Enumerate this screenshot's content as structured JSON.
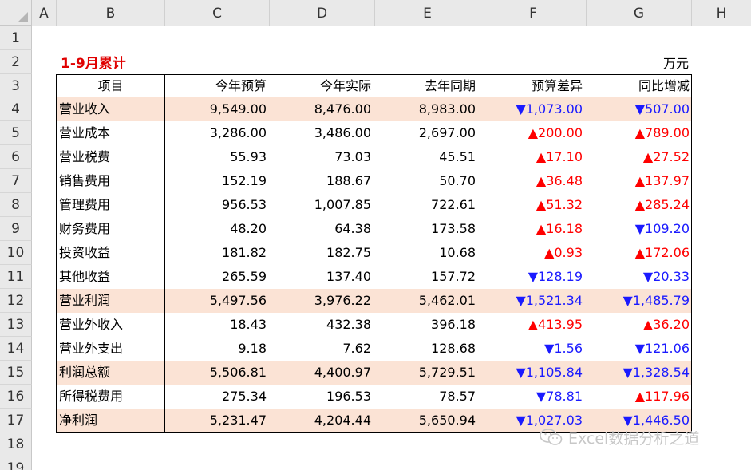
{
  "columns": [
    "A",
    "B",
    "C",
    "D",
    "E",
    "F",
    "G",
    "H"
  ],
  "rows": [
    "1",
    "2",
    "3",
    "4",
    "5",
    "6",
    "7",
    "8",
    "9",
    "10",
    "11",
    "12",
    "13",
    "14",
    "15",
    "16",
    "17",
    "18",
    "19"
  ],
  "title": "1-9月累计",
  "unit": "万元",
  "headers": [
    "项目",
    "今年预算",
    "今年实际",
    "去年同期",
    "预算差异",
    "同比增减"
  ],
  "table_rows": [
    {
      "item": "营业收入",
      "budget": "9,549.00",
      "actual": "8,476.00",
      "last": "8,983.00",
      "diff": "▼1,073.00",
      "diff_dir": "down",
      "yoy": "▼507.00",
      "yoy_dir": "down",
      "shade": true
    },
    {
      "item": "营业成本",
      "budget": "3,286.00",
      "actual": "3,486.00",
      "last": "2,697.00",
      "diff": "▲200.00",
      "diff_dir": "up",
      "yoy": "▲789.00",
      "yoy_dir": "up",
      "shade": false
    },
    {
      "item": "营业税费",
      "budget": "55.93",
      "actual": "73.03",
      "last": "45.51",
      "diff": "▲17.10",
      "diff_dir": "up",
      "yoy": "▲27.52",
      "yoy_dir": "up",
      "shade": false
    },
    {
      "item": "销售费用",
      "budget": "152.19",
      "actual": "188.67",
      "last": "50.70",
      "diff": "▲36.48",
      "diff_dir": "up",
      "yoy": "▲137.97",
      "yoy_dir": "up",
      "shade": false
    },
    {
      "item": "管理费用",
      "budget": "956.53",
      "actual": "1,007.85",
      "last": "722.61",
      "diff": "▲51.32",
      "diff_dir": "up",
      "yoy": "▲285.24",
      "yoy_dir": "up",
      "shade": false
    },
    {
      "item": "财务费用",
      "budget": "48.20",
      "actual": "64.38",
      "last": "173.58",
      "diff": "▲16.18",
      "diff_dir": "up",
      "yoy": "▼109.20",
      "yoy_dir": "down",
      "shade": false
    },
    {
      "item": "投资收益",
      "budget": "181.82",
      "actual": "182.75",
      "last": "10.68",
      "diff": "▲0.93",
      "diff_dir": "up",
      "yoy": "▲172.06",
      "yoy_dir": "up",
      "shade": false
    },
    {
      "item": "其他收益",
      "budget": "265.59",
      "actual": "137.40",
      "last": "157.72",
      "diff": "▼128.19",
      "diff_dir": "down",
      "yoy": "▼20.33",
      "yoy_dir": "down",
      "shade": false
    },
    {
      "item": "营业利润",
      "budget": "5,497.56",
      "actual": "3,976.22",
      "last": "5,462.01",
      "diff": "▼1,521.34",
      "diff_dir": "down",
      "yoy": "▼1,485.79",
      "yoy_dir": "down",
      "shade": true
    },
    {
      "item": "营业外收入",
      "budget": "18.43",
      "actual": "432.38",
      "last": "396.18",
      "diff": "▲413.95",
      "diff_dir": "up",
      "yoy": "▲36.20",
      "yoy_dir": "up",
      "shade": false
    },
    {
      "item": "营业外支出",
      "budget": "9.18",
      "actual": "7.62",
      "last": "128.68",
      "diff": "▼1.56",
      "diff_dir": "down",
      "yoy": "▼121.06",
      "yoy_dir": "down",
      "shade": false
    },
    {
      "item": "利润总额",
      "budget": "5,506.81",
      "actual": "4,400.97",
      "last": "5,729.51",
      "diff": "▼1,105.84",
      "diff_dir": "down",
      "yoy": "▼1,328.54",
      "yoy_dir": "down",
      "shade": true
    },
    {
      "item": "所得税费用",
      "budget": "275.34",
      "actual": "196.53",
      "last": "78.57",
      "diff": "▼78.81",
      "diff_dir": "down",
      "yoy": "▲117.96",
      "yoy_dir": "up",
      "shade": false
    },
    {
      "item": "净利润",
      "budget": "5,231.47",
      "actual": "4,204.44",
      "last": "5,650.94",
      "diff": "▼1,027.03",
      "diff_dir": "down",
      "yoy": "▼1,446.50",
      "yoy_dir": "down",
      "shade": true
    }
  ],
  "watermark": "Excel数据分析之道",
  "colors": {
    "shade": "#fbe3d5",
    "up": "#ff0000",
    "down": "#1a1aff",
    "title": "#e00000"
  }
}
